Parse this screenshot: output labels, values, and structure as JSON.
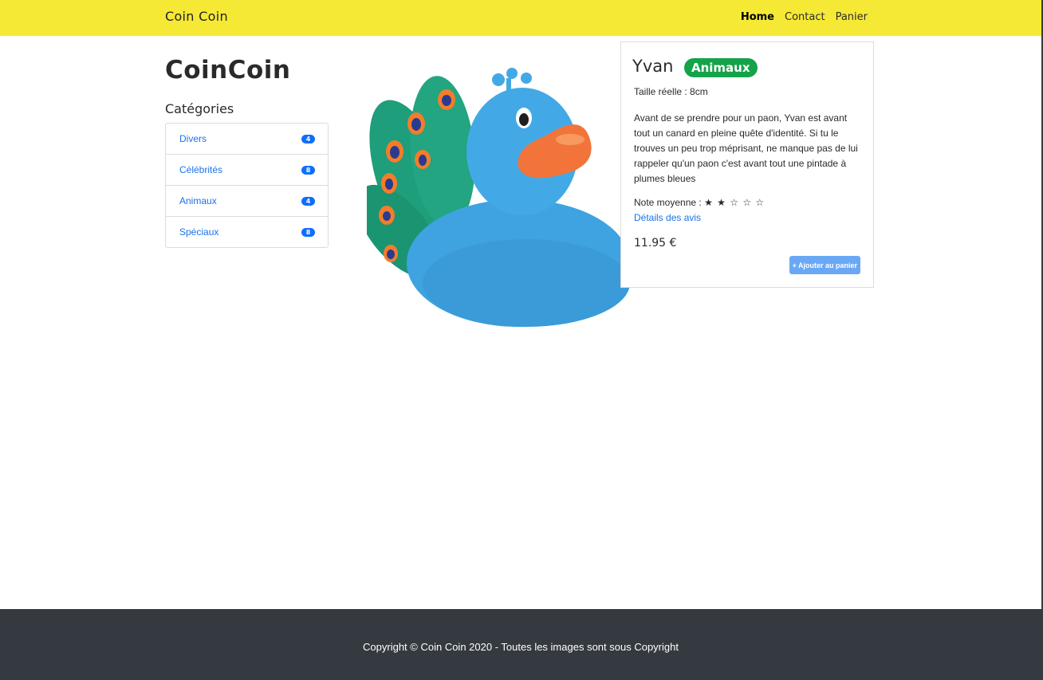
{
  "navbar": {
    "brand": "Coin Coin",
    "links": [
      "Home",
      "Contact",
      "Panier"
    ],
    "active": "Home"
  },
  "sidebar": {
    "site_title": "CoinCoin",
    "heading": "Catégories",
    "categories": [
      {
        "label": "Divers",
        "count": "4"
      },
      {
        "label": "Célébrités",
        "count": "8"
      },
      {
        "label": "Animaux",
        "count": "4"
      },
      {
        "label": "Spéciaux",
        "count": "8"
      }
    ]
  },
  "product": {
    "name": "Yvan",
    "category": "Animaux",
    "size": "Taille réelle : 8cm",
    "description": "Avant de se prendre pour un paon, Yvan est avant tout un canard en pleine quête d'identité. Si tu le trouves un peu trop méprisant, ne manque pas de lui rappeler qu'un paon c'est avant tout une pintade à plumes bleues",
    "rating_label": "Note moyenne :",
    "rating_stars": "★ ★ ☆ ☆ ☆",
    "rating_value": 2,
    "rating_max": 5,
    "reviews_link": "Détails des avis",
    "price": "11.95  €",
    "add_to_cart": "+ Ajouter au panier"
  },
  "footer": {
    "copyright": "Copyright © Coin Coin 2020 - Toutes les images sont sous Copyright"
  },
  "colors": {
    "navbar": "#f5e935",
    "footer": "#343a40",
    "link": "#1a73e8",
    "badge": "#0d6efd",
    "category_badge": "#15a34a",
    "button": "#6aa8f5"
  }
}
